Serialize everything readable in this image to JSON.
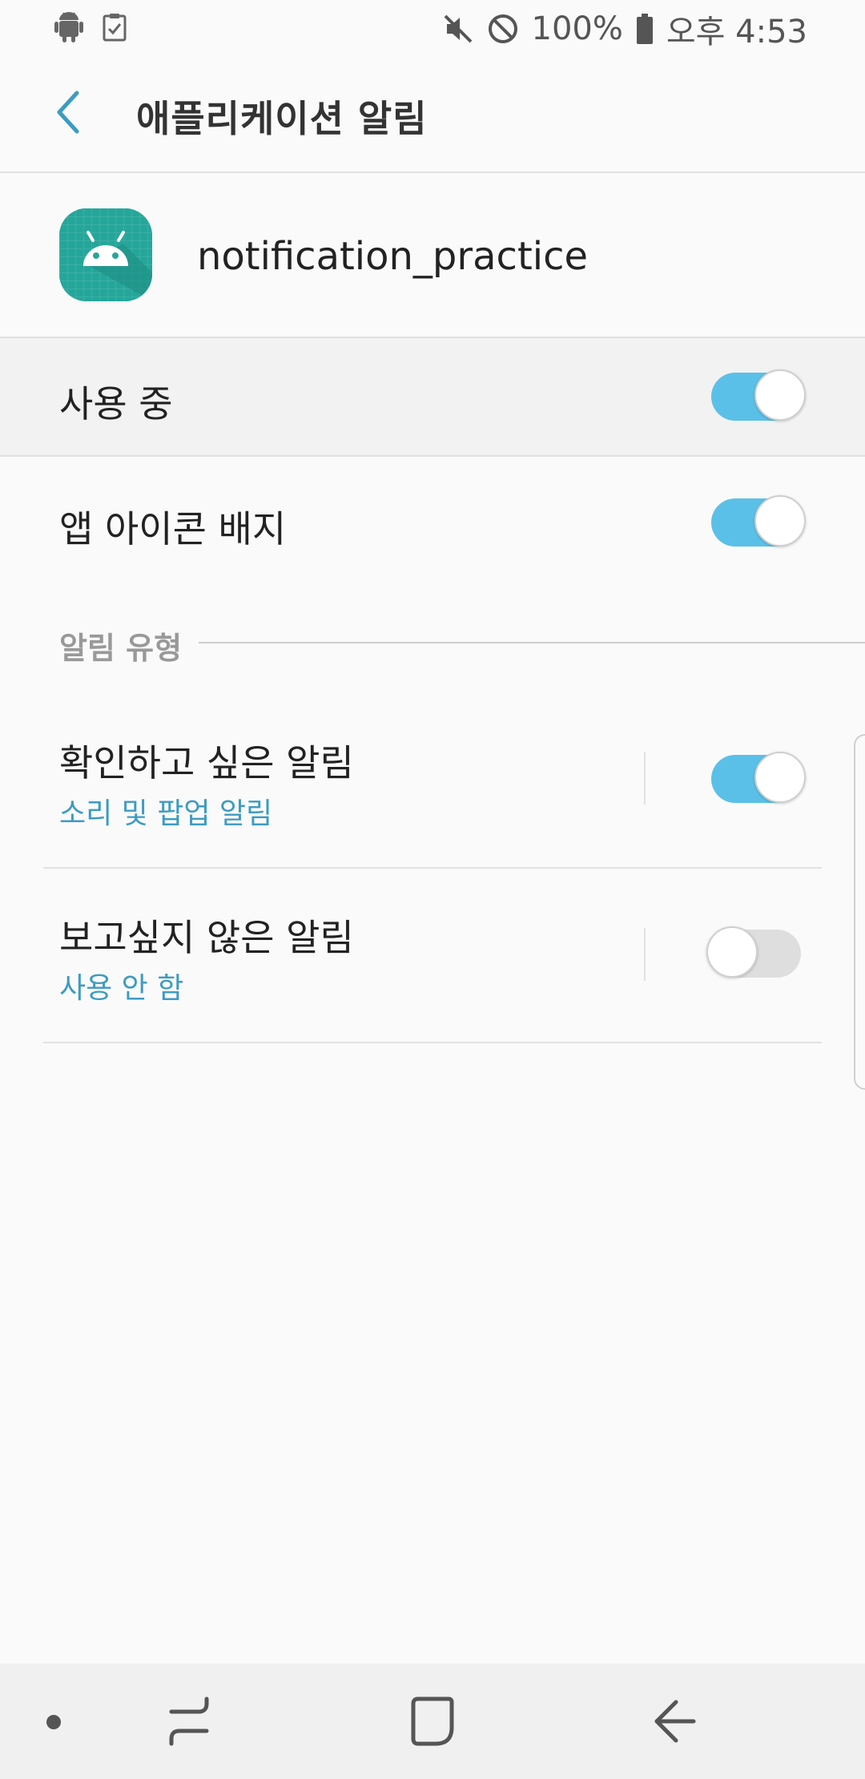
{
  "status_bar": {
    "left_icons": [
      "android-icon",
      "clipboard-check-icon"
    ],
    "right_icons": [
      "mute-icon",
      "do-not-disturb-icon",
      "battery-icon"
    ],
    "battery": "100%",
    "time": "오후 4:53"
  },
  "app_bar": {
    "title": "애플리케이션 알림",
    "back_icon": "chevron-left-icon"
  },
  "app_header": {
    "app_name": "notification_practice",
    "icon": "android-app-icon"
  },
  "settings": {
    "in_use": {
      "label": "사용 중",
      "enabled": true
    },
    "app_icon_badge": {
      "label": "앱 아이콘 배지",
      "enabled": true
    }
  },
  "notification_types": {
    "section_title": "알림 유형",
    "items": [
      {
        "label": "확인하고 싶은 알림",
        "sub": "소리 및 팝업 알림",
        "enabled": true
      },
      {
        "label": "보고싶지 않은 알림",
        "sub": "사용 안 함",
        "enabled": false
      }
    ]
  },
  "nav_bar": {
    "items": [
      "dot-icon",
      "recent-apps-icon",
      "home-icon",
      "back-icon"
    ]
  },
  "colors": {
    "accent": "#5bc0e8",
    "subtext": "#3d9bc1",
    "app_icon": "#26a69a"
  }
}
